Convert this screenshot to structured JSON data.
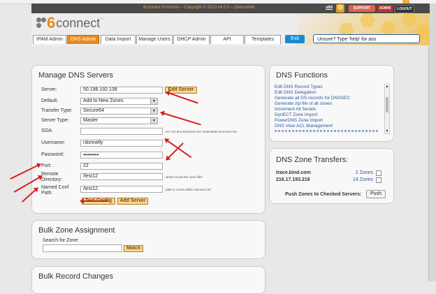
{
  "header": {
    "copyright": "6connect ProVision – Copyright © 2013 v4.0.0 – (Secure64)",
    "user": "s64",
    "support_label": "SUPPORT",
    "admin_label": "ADMIN",
    "logout_label": "LOGOUT",
    "logo_num": "6",
    "logo_text": "connect",
    "logo_tm": "™",
    "exit_label": "Exit",
    "help_value": "Unsure? Type 'help' for ass",
    "tabs": [
      {
        "label": "IPAM Admin"
      },
      {
        "label": "DNS Admin"
      },
      {
        "label": "Data Import"
      },
      {
        "label": "Manage Users"
      },
      {
        "label": "DHCP Admin"
      },
      {
        "label": "API"
      },
      {
        "label": "Templates"
      }
    ]
  },
  "manage": {
    "title": "Manage DNS Servers",
    "server_label": "Server:",
    "server_value": "50.198.192.138",
    "edit_server": "Edit Server",
    "default_label": "Default:",
    "default_value": "Add to New Zones",
    "transfer_label": "Transfer Type:",
    "transfer_value": "Secure64",
    "servertype_label": "Server Type:",
    "servertype_value": "Master",
    "soa_label": "SOA:",
    "soa_value": "",
    "soa_hint": "ex: ns1.dns.6connect.net. hostmaster.6connect.net.",
    "username_label": "Username:",
    "username_value": "rdonnelly",
    "password_label": "Password:",
    "password_value": "••••••••",
    "port_label": "Port:",
    "port_value": "22",
    "remote_label_1": "Remote",
    "remote_label_2": "Directory:",
    "remote_value": "/test12",
    "remote_hint": "where to put the zone files",
    "named_label_1": "Named Conf",
    "named_label_2": "Path:",
    "named_value": "/test12",
    "named_hint": "path to zones within named.conf",
    "test_config": "Test Config",
    "add_server": "Add Server"
  },
  "functions": {
    "title": "DNS Functions",
    "links": [
      "Edit DNS Record Types",
      "Edit DNS Delegation",
      "Generate all DS records for DNSSEC",
      "Generate zip file of all zones",
      "Increment All Serials",
      "DynECT Zone Import",
      "PowerDNS Zone Import",
      "DNS View ACL Management"
    ]
  },
  "transfers": {
    "title": "DNS Zone Transfers:",
    "rows": [
      {
        "server": "trace.bind.com",
        "count": "2 Zones"
      },
      {
        "server": "216.17.193.216",
        "count": "14 Zones"
      }
    ],
    "push_label": "Push Zones to Checked Servers:",
    "push_button": "Push"
  },
  "bulk_zone": {
    "title": "Bulk Zone Assignment",
    "search_label": "Search for Zone:",
    "search_value": "",
    "match_button": "Match"
  },
  "bulk_record": {
    "title": "Bulk Record Changes"
  },
  "colors": {
    "accent": "#e88a1a",
    "link": "#2a5aa0",
    "arrow": "#d82020"
  }
}
